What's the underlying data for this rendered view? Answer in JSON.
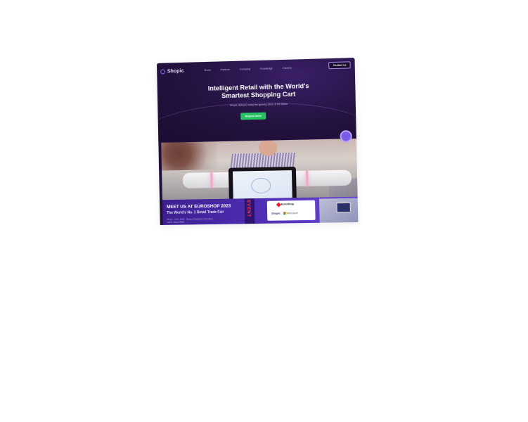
{
  "nav": {
    "logo_text": "Shopic",
    "links": [
      "Home",
      "Platform",
      "Company",
      "Knowledge",
      "Careers"
    ],
    "contact_label": "Contact us"
  },
  "hero": {
    "title_line1": "Intelligent Retail with the World's",
    "title_line2": "Smartest Shopping Cart",
    "subtitle": "Shopic delivers today the grocery store of the future",
    "cta_label": "Request demo"
  },
  "banner": {
    "title": "MEET US AT EUROSHOP 2023",
    "subtitle": "The World's No. 1 Retail Trade Fair",
    "info_line1": "26.02. - 2.03. 2023 · Messe Düsseldorf, Germany",
    "info_line2": "Hall 6, Stand 6B56",
    "event_label": "EVENT",
    "euroshop_logo": "EuroShop",
    "partners": [
      "Shopic",
      "Microsoft"
    ]
  },
  "colors": {
    "hero_bg": "#23123f",
    "cta_green": "#27c164",
    "banner_purple": "#4d2bb0",
    "event_red": "#ff3c5c"
  }
}
